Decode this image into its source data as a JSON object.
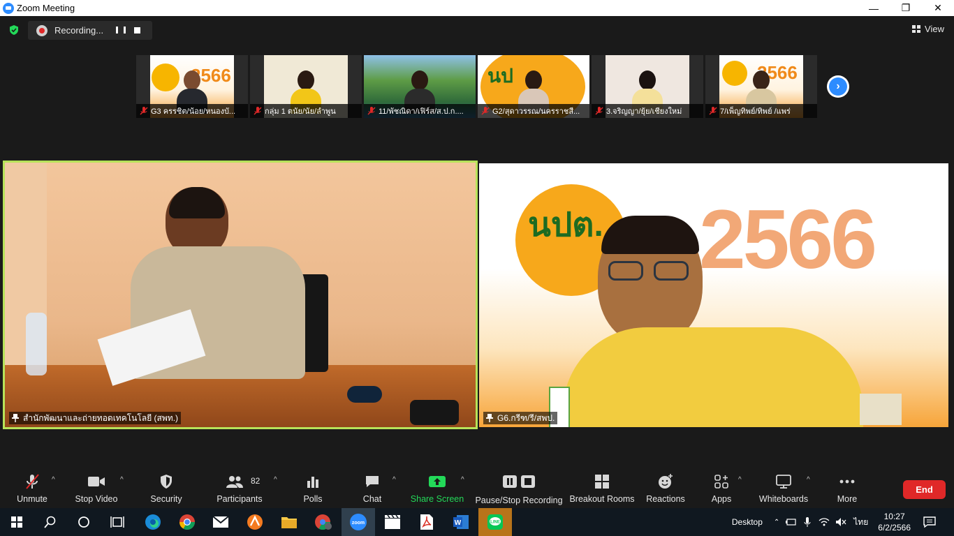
{
  "window": {
    "title": "Zoom Meeting",
    "minimize": "—",
    "maximize": "❐",
    "close": "✕"
  },
  "recording": {
    "label": "Recording..."
  },
  "view_button": {
    "label": "View"
  },
  "thumbnails": [
    {
      "name": "G3 ครรชิต/น้อย/หนองบั...",
      "muted": true
    },
    {
      "name": "กลุ่ม 1 ตนัย/นัย/ลำพูน",
      "muted": true
    },
    {
      "name": "11/พัชณิดา/เฟิร์ส/ส.ป.ก....",
      "muted": true
    },
    {
      "name": "G2/สุดาวรรณ/นครราชสี...",
      "muted": true
    },
    {
      "name": "3.จริญญา/ยุ้ย/เชียงใหม่",
      "muted": true
    },
    {
      "name": "7/เพ็ญทิพย์/ทิพย์ /แพร่",
      "muted": true
    }
  ],
  "main_videos": [
    {
      "name": "สำนักพัฒนาและถ่ายทอดเทคโนโลยี (สพท.)",
      "active_speaker": true
    },
    {
      "name": "G6.กรีฑ/รี/สพป.",
      "active_speaker": false,
      "banner_text": "2566",
      "logo_text": "นปต."
    }
  ],
  "toolbar": {
    "unmute": "Unmute",
    "stop_video": "Stop Video",
    "security": "Security",
    "participants": "Participants",
    "participants_count": "82",
    "polls": "Polls",
    "chat": "Chat",
    "share_screen": "Share Screen",
    "pause_stop_recording": "Pause/Stop Recording",
    "breakout_rooms": "Breakout Rooms",
    "reactions": "Reactions",
    "apps": "Apps",
    "whiteboards": "Whiteboards",
    "more": "More",
    "end": "End"
  },
  "taskbar": {
    "desktop_label": "Desktop",
    "language": "ไทย",
    "time": "10:27",
    "date": "6/2/2566"
  },
  "colors": {
    "active_speaker_border": "#b7e35a",
    "share_green": "#23d959",
    "end_red": "#e02828",
    "zoom_blue": "#2d8cff"
  }
}
